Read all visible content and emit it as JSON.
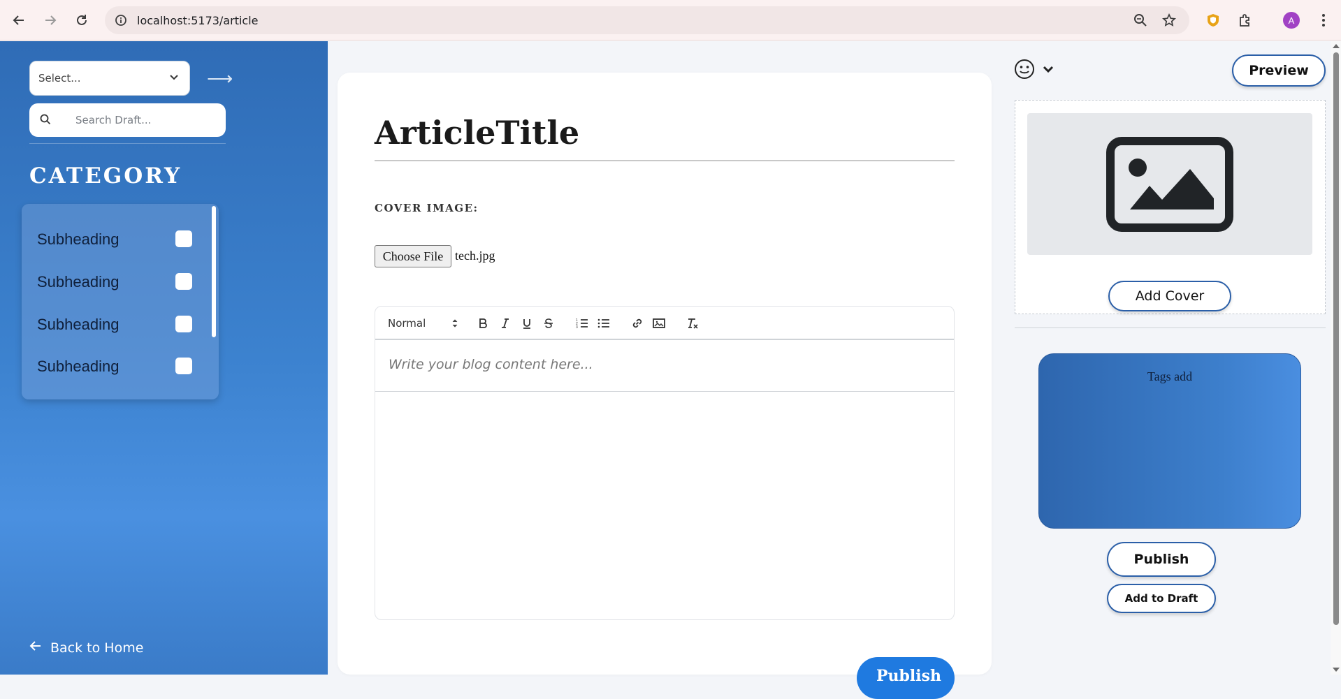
{
  "browser": {
    "url": "localhost:5173/article",
    "avatar_letter": "A",
    "icons": [
      "back-arrow-icon",
      "forward-arrow-icon",
      "reload-icon",
      "site-info-icon",
      "zoom-icon",
      "bookmark-star-icon",
      "shield-extension-icon",
      "extensions-puzzle-icon",
      "avatar",
      "kebab-menu-icon"
    ]
  },
  "sidebar": {
    "select_value": "Select...",
    "search_placeholder": "Search Draft...",
    "category_title": "CATEGORY",
    "categories": [
      {
        "label": "Subheading",
        "checked": false
      },
      {
        "label": "Subheading",
        "checked": false
      },
      {
        "label": "Subheading",
        "checked": false
      },
      {
        "label": "Subheading",
        "checked": false
      }
    ],
    "back_label": "Back to Home"
  },
  "editor": {
    "title": "ArticleTitle",
    "cover_label": "COVER IMAGE:",
    "choose_file_label": "Choose File",
    "file_name": "tech.jpg",
    "toolbar": {
      "format_value": "Normal",
      "buttons": [
        "bold-icon",
        "italic-icon",
        "underline-icon",
        "strike-icon",
        "ordered-list-icon",
        "bullet-list-icon",
        "link-icon",
        "image-icon",
        "clear-format-icon"
      ]
    },
    "content_placeholder": "Write your blog content here...",
    "publish_partial_label": "Publish"
  },
  "right_panel": {
    "preview_label": "Preview",
    "add_cover_label": "Add Cover",
    "tags_label": "Tags add",
    "publish_label": "Publish",
    "draft_label": "Add to Draft"
  },
  "colors": {
    "sidebar_top": "#2f6cb6",
    "sidebar_mid": "#4a90e0",
    "accent_border": "#2b5fa8",
    "publish_blue": "#1f7ae0"
  }
}
